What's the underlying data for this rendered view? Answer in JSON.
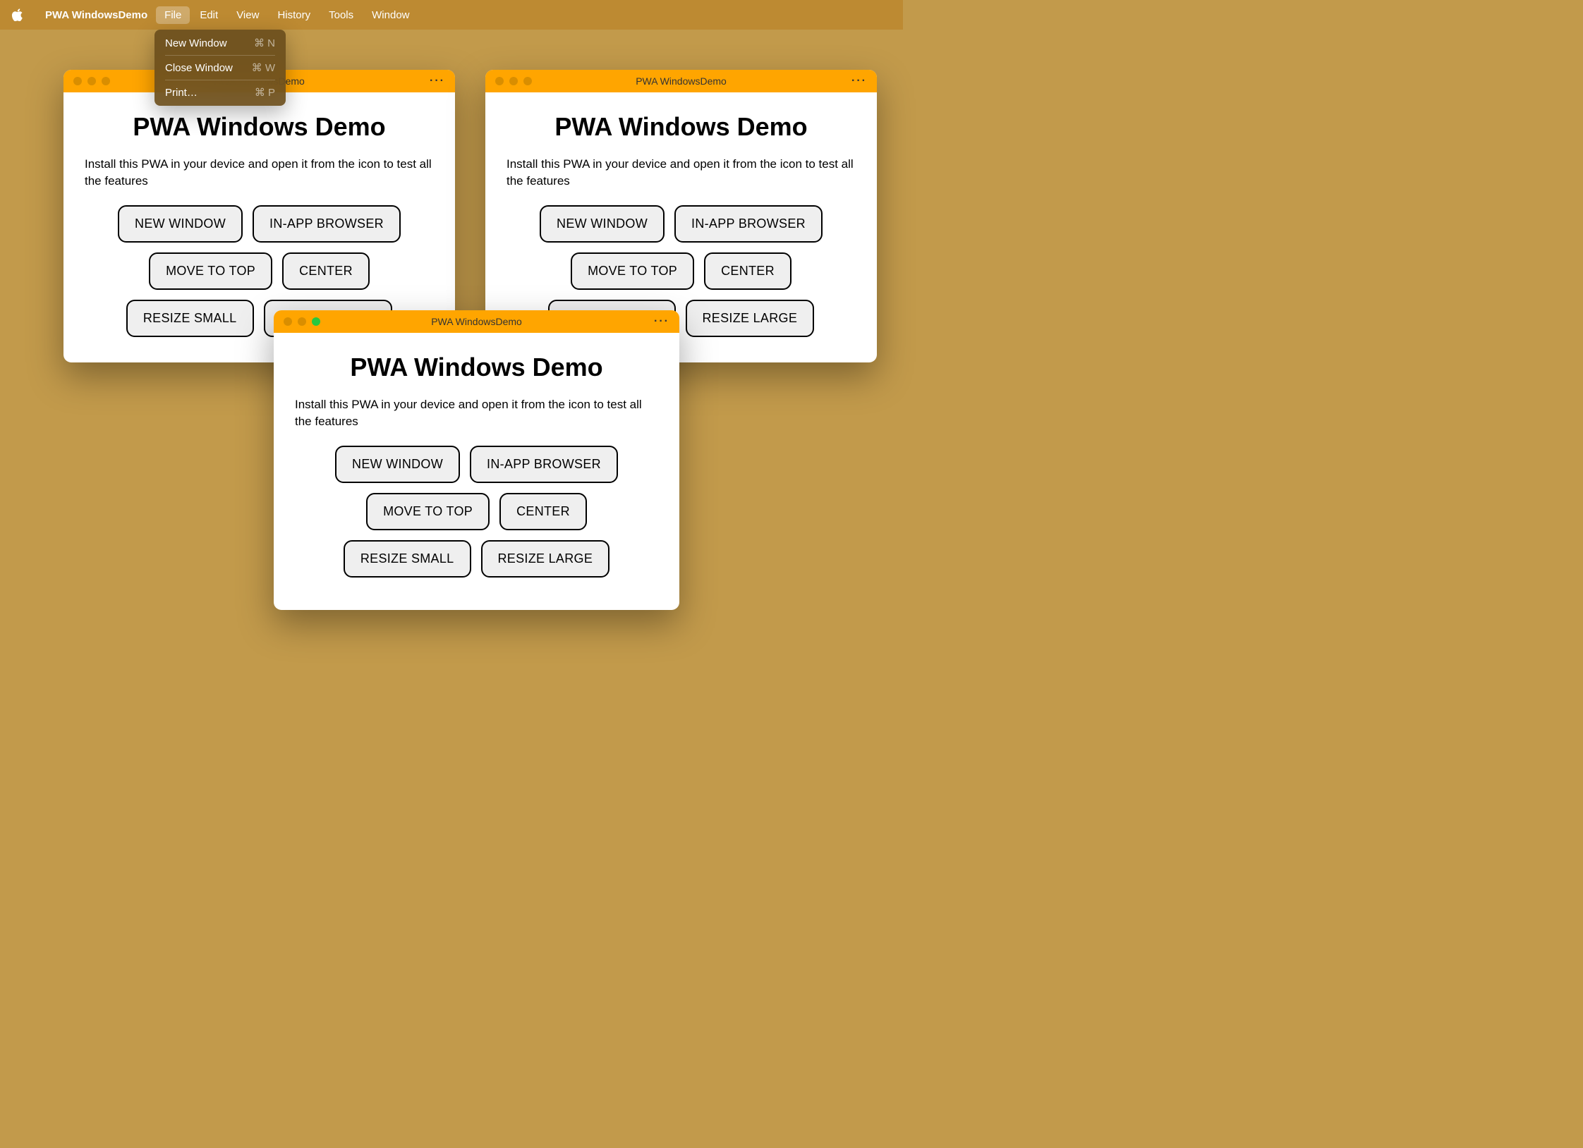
{
  "menubar": {
    "app_name": "PWA WindowsDemo",
    "items": [
      "File",
      "Edit",
      "View",
      "History",
      "Tools",
      "Window"
    ],
    "selected_index": 0
  },
  "dropdown": {
    "items": [
      {
        "label": "New Window",
        "shortcut": "⌘ N"
      },
      {
        "label": "Close Window",
        "shortcut": "⌘ W"
      },
      {
        "label": "Print…",
        "shortcut": "⌘ P"
      }
    ]
  },
  "window": {
    "title": "PWA WindowsDemo",
    "heading": "PWA Windows Demo",
    "description": "Install this PWA in your device and open it from the icon to test all the features",
    "buttons": [
      "NEW WINDOW",
      "IN-APP BROWSER",
      "MOVE TO TOP",
      "CENTER",
      "RESIZE SMALL",
      "RESIZE LARGE"
    ],
    "more": "···"
  }
}
